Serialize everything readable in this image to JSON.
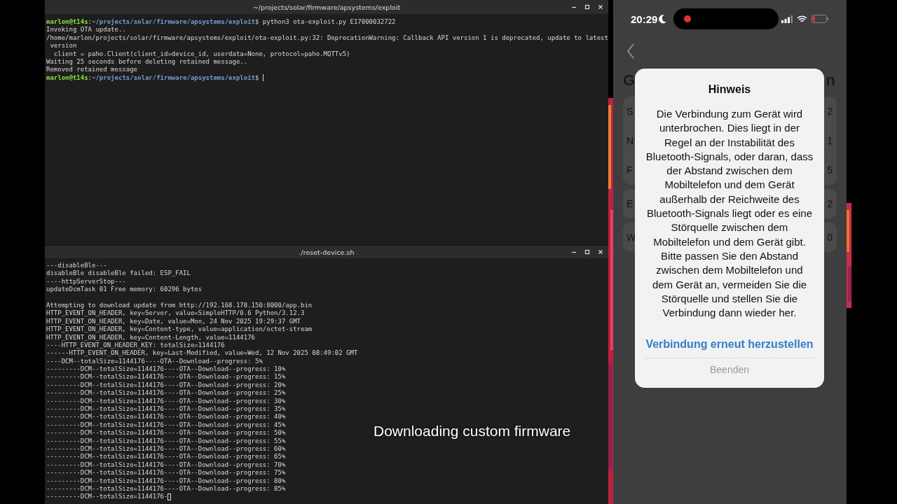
{
  "terminals": [
    {
      "title": "~/projects/solar/firmware/apsystems/exploit",
      "lines": [
        {
          "kind": "prompt",
          "user": "marlon@t14s",
          "separator": ":",
          "path": "~/projects/solar/firmware/apsystems/exploit",
          "sign": "$",
          "command": "python3 ota-exploit.py E17000032722"
        },
        {
          "kind": "output",
          "text": "Invoking OTA update.."
        },
        {
          "kind": "output",
          "text": "/home/marlon/projects/solar/firmware/apsystems/exploit/ota-exploit.py:32: DeprecationWarning: Callback API version 1 is deprecated, update to latest"
        },
        {
          "kind": "output",
          "text": " version"
        },
        {
          "kind": "output",
          "text": "  client = paho.Client(client_id=device_id, userdata=None, protocol=paho.MQTTv5)"
        },
        {
          "kind": "output",
          "text": "Waiting 25 seconds before deleting retained message.."
        },
        {
          "kind": "output",
          "text": "Removed retained message"
        },
        {
          "kind": "prompt",
          "user": "marlon@t14s",
          "separator": ":",
          "path": "~/projects/solar/firmware/apsystems/exploit",
          "sign": "$",
          "cursor": true
        }
      ]
    },
    {
      "title": "./reset-device.sh",
      "lines": [
        {
          "kind": "output",
          "text": "---disableBle---"
        },
        {
          "kind": "output",
          "text": "disableBle disableBle failed: ESP_FAIL"
        },
        {
          "kind": "output",
          "text": "----httpServerStop---"
        },
        {
          "kind": "output",
          "text": "updateDcmTask 01 Free memory: 60296 bytes"
        },
        {
          "kind": "blank"
        },
        {
          "kind": "output",
          "text": "Attempting to download update from http://192.168.178.150:8000/app.bin"
        },
        {
          "kind": "output",
          "text": "HTTP_EVENT_ON_HEADER, key=Server, value=SimpleHTTP/0.6 Python/3.12.3"
        },
        {
          "kind": "output",
          "text": "HTTP_EVENT_ON_HEADER, key=Date, value=Mon, 24 Nov 2025 19:29:37 GMT"
        },
        {
          "kind": "output",
          "text": "HTTP_EVENT_ON_HEADER, key=Content-type, value=application/octet-stream"
        },
        {
          "kind": "output",
          "text": "HTTP_EVENT_ON_HEADER, key=Content-Length, value=1144176"
        },
        {
          "kind": "output",
          "text": "----HTTP_EVENT_ON_HEADER_KEY: totalSize=1144176"
        },
        {
          "kind": "output",
          "text": "------HTTP_EVENT_ON_HEADER, key=Last-Modified, value=Wed, 12 Nov 2025 08:49:02 GMT"
        },
        {
          "kind": "output",
          "text": "----DCM--totalSize=1144176----OTA--Download--progress: 5%"
        },
        {
          "kind": "output",
          "text": "---------DCM--totalSize=1144176----OTA--Download--progress: 10%"
        },
        {
          "kind": "output",
          "text": "---------DCM--totalSize=1144176----OTA--Download--progress: 15%"
        },
        {
          "kind": "output",
          "text": "---------DCM--totalSize=1144176----OTA--Download--progress: 20%"
        },
        {
          "kind": "output",
          "text": "---------DCM--totalSize=1144176----OTA--Download--progress: 25%"
        },
        {
          "kind": "output",
          "text": "---------DCM--totalSize=1144176----OTA--Download--progress: 30%"
        },
        {
          "kind": "output",
          "text": "---------DCM--totalSize=1144176----OTA--Download--progress: 35%"
        },
        {
          "kind": "output",
          "text": "---------DCM--totalSize=1144176----OTA--Download--progress: 40%"
        },
        {
          "kind": "output",
          "text": "---------DCM--totalSize=1144176----OTA--Download--progress: 45%"
        },
        {
          "kind": "output",
          "text": "---------DCM--totalSize=1144176----OTA--Download--progress: 50%"
        },
        {
          "kind": "output",
          "text": "---------DCM--totalSize=1144176----OTA--Download--progress: 55%"
        },
        {
          "kind": "output",
          "text": "---------DCM--totalSize=1144176----OTA--Download--progress: 60%"
        },
        {
          "kind": "output",
          "text": "---------DCM--totalSize=1144176----OTA--Download--progress: 65%"
        },
        {
          "kind": "output",
          "text": "---------DCM--totalSize=1144176----OTA--Download--progress: 70%"
        },
        {
          "kind": "output",
          "text": "---------DCM--totalSize=1144176----OTA--Download--progress: 75%"
        },
        {
          "kind": "output",
          "text": "---------DCM--totalSize=1144176----OTA--Download--progress: 80%"
        },
        {
          "kind": "output",
          "text": "---------DCM--totalSize=1144176----OTA--Download--progress: 85%"
        },
        {
          "kind": "output",
          "text": "---------DCM--totalSize=1144176-",
          "cursor": true
        }
      ]
    }
  ],
  "caption": "Downloading custom firmware",
  "phone": {
    "status_bar": {
      "time": "20:29"
    },
    "heading": {
      "start": "G",
      "end": "n"
    },
    "cards": [
      {
        "rows": [
          {
            "start": "S",
            "end": "2"
          },
          {
            "start": "N",
            "end": "1"
          },
          {
            "start": "F",
            "end": "5"
          }
        ]
      },
      {
        "rows": [
          {
            "start": "E",
            "end": "2"
          }
        ]
      },
      {
        "rows": [
          {
            "start": "W",
            "end": "0"
          }
        ]
      }
    ],
    "dialog": {
      "title": "Hinweis",
      "message": "Die Verbindung zum Gerät wird unterbrochen. Dies liegt in der Regel an der Instabilität des Bluetooth-Signals, oder daran, dass der Abstand zwischen dem Mobiltelefon und dem Gerät außerhalb der Reichweite des Bluetooth-Signals liegt oder es eine Störquelle zwischen dem Mobiltelefon und dem Gerät gibt. Bitte passen Sie den Abstand zwischen dem Mobiltelefon und dem Gerät an, vermeiden Sie die Störquelle und stellen Sie die Verbindung dann wieder her.",
      "buttons": [
        {
          "label": "Verbindung erneut herzustellen",
          "kind": "primary"
        },
        {
          "label": "Beenden",
          "kind": "secondary"
        }
      ]
    }
  }
}
